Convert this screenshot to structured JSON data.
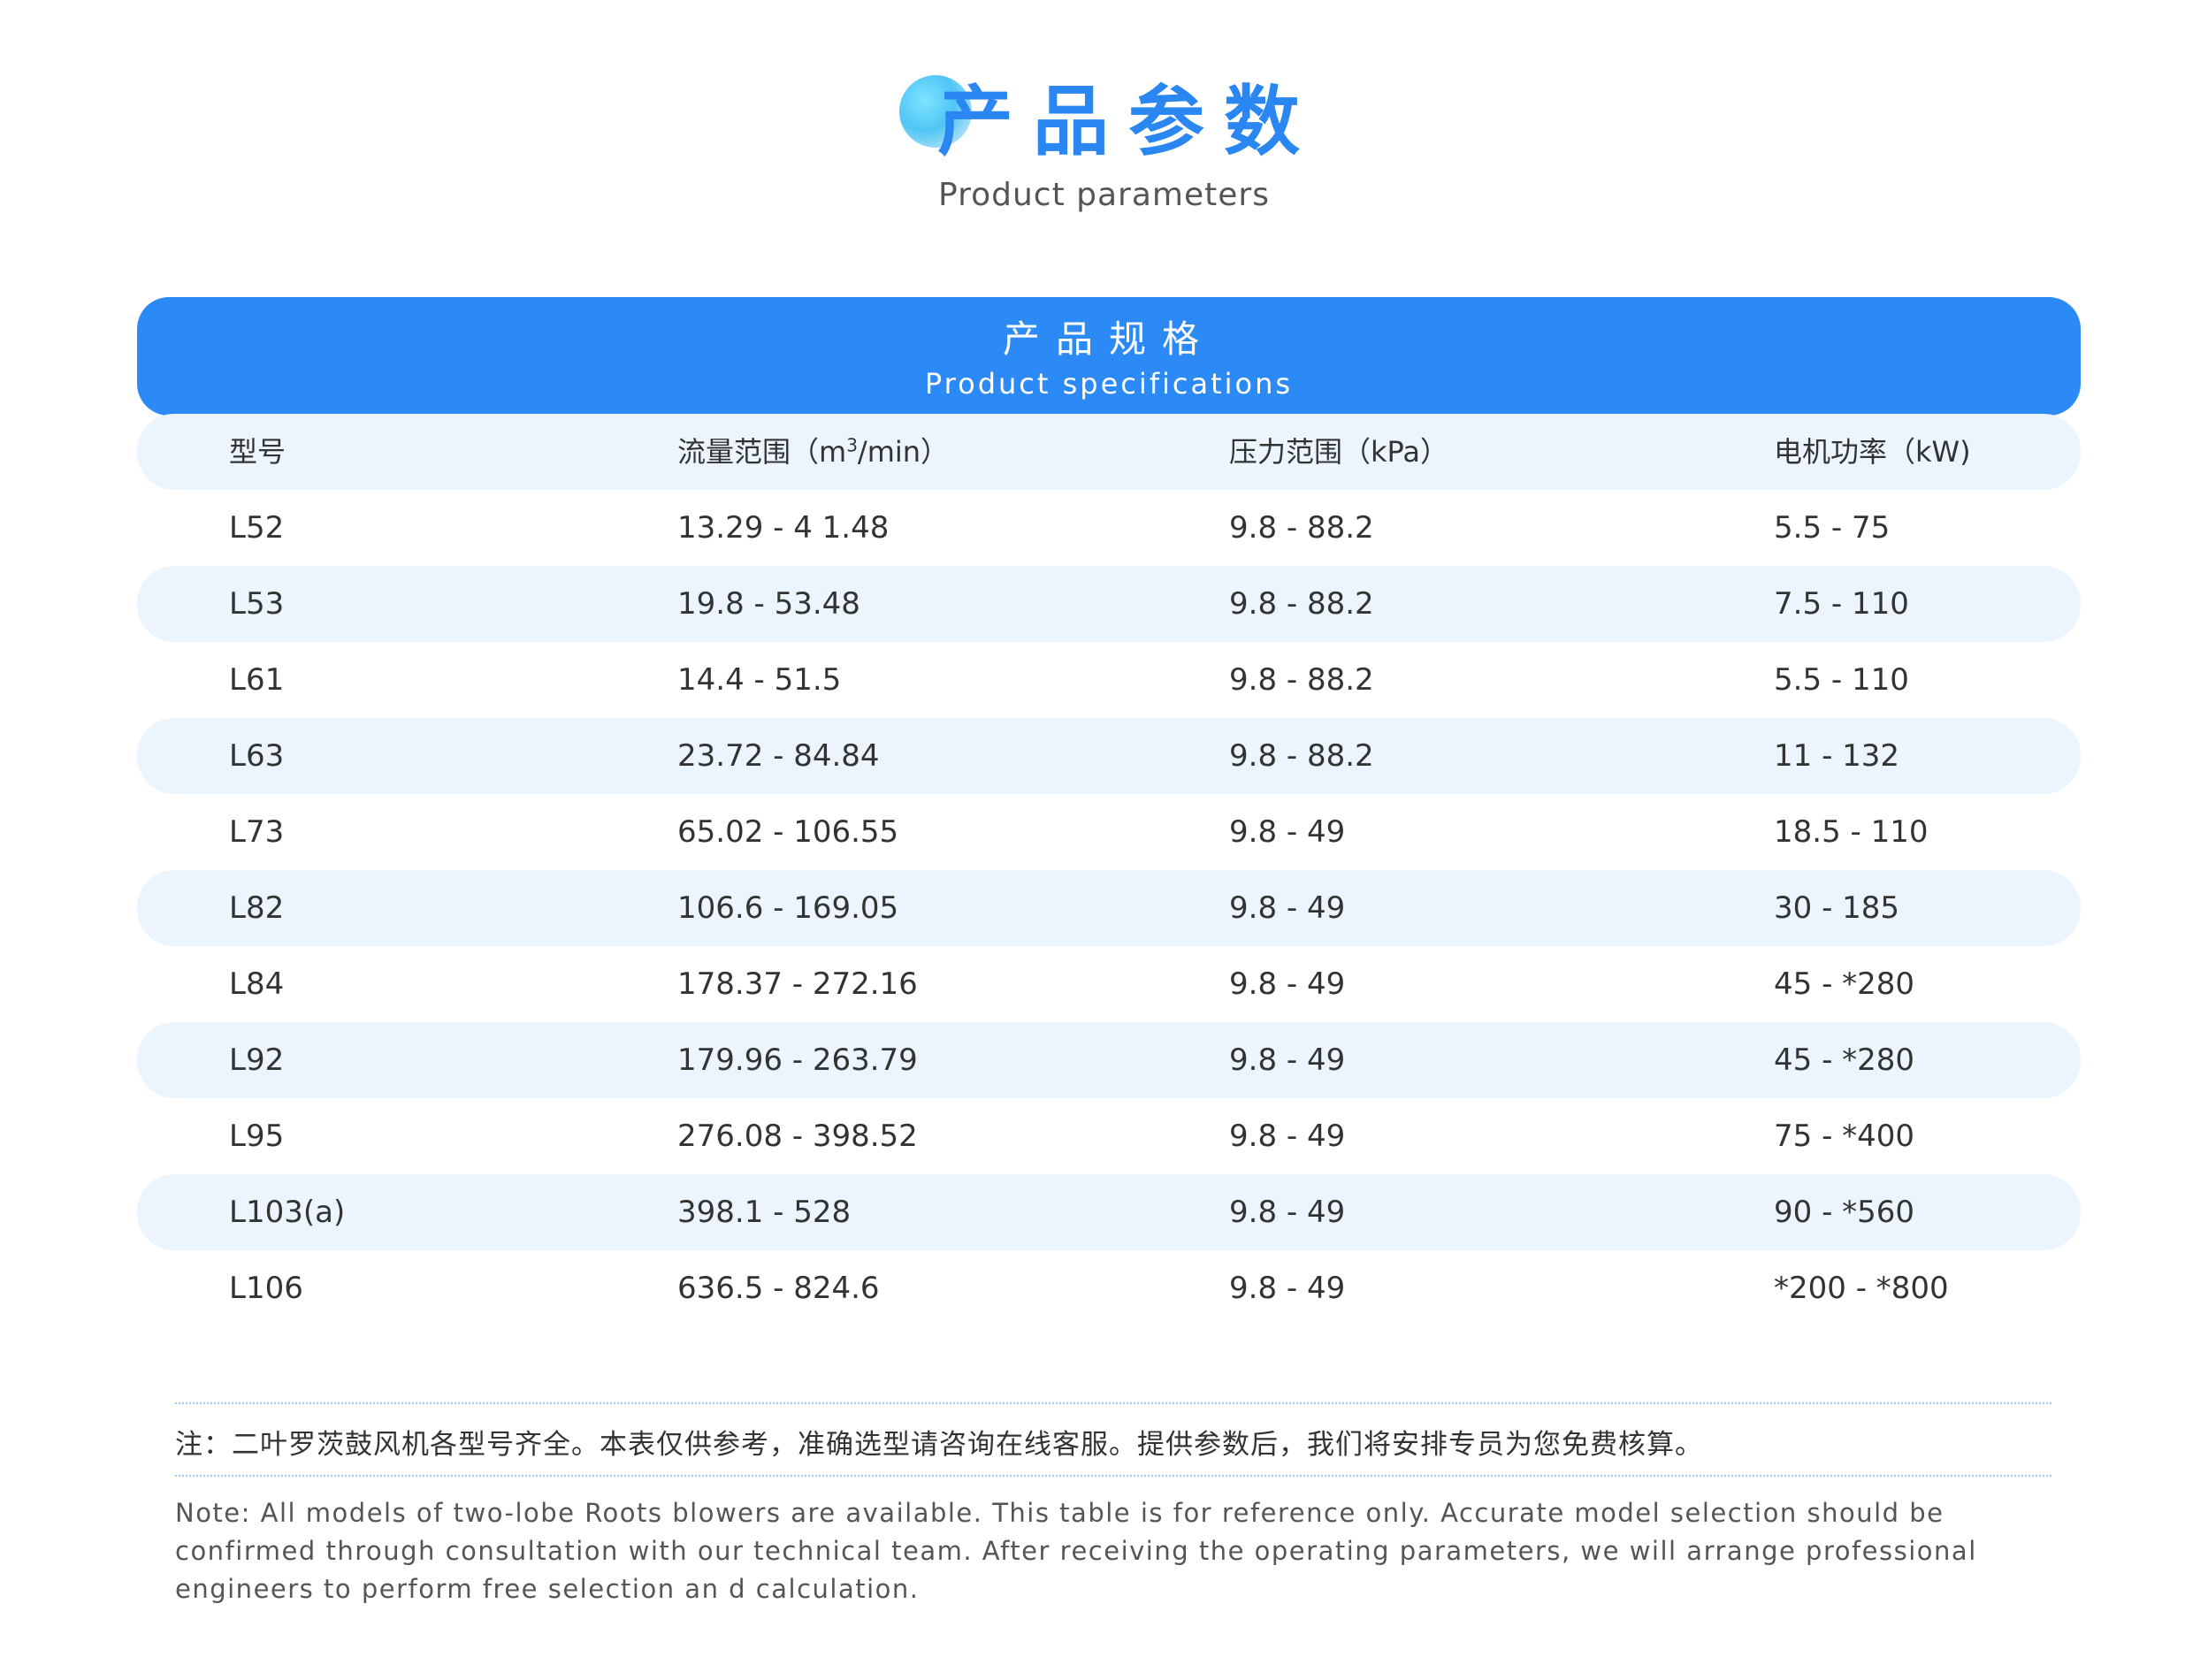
{
  "heading": {
    "title": "产品参数",
    "subtitle": "Product parameters"
  },
  "table": {
    "title": "产品规格",
    "subtitle": "Product specifications",
    "columns": {
      "model": "型号",
      "flow_prefix": "流量范围（m",
      "flow_sup": "3",
      "flow_suffix": "/min）",
      "pressure": "压力范围（kPa）",
      "power": "电机功率（kW)"
    },
    "rows": [
      {
        "model": "L52",
        "flow": "13.29  - 4 1.48",
        "pressure": "9.8 - 88.2",
        "power": "5.5 - 75"
      },
      {
        "model": "L53",
        "flow": "19.8  - 53.48",
        "pressure": "9.8 - 88.2",
        "power": "7.5 - 110"
      },
      {
        "model": "L61",
        "flow": "14.4 - 51.5",
        "pressure": "9.8 - 88.2",
        "power": "5.5 - 110"
      },
      {
        "model": "L63",
        "flow": "23.72 - 84.84",
        "pressure": "9.8 - 88.2",
        "power": "11 - 132"
      },
      {
        "model": "L73",
        "flow": "65.02 - 106.55",
        "pressure": "9.8 - 49",
        "power": "18.5 - 110"
      },
      {
        "model": "L82",
        "flow": "106.6 - 169.05",
        "pressure": "9.8 - 49",
        "power": "30 - 185"
      },
      {
        "model": "L84",
        "flow": "178.37 - 272.16",
        "pressure": "9.8 - 49",
        "power": "45 - *280"
      },
      {
        "model": "L92",
        "flow": "179.96 - 263.79",
        "pressure": "9.8 - 49",
        "power": "45 - *280"
      },
      {
        "model": "L95",
        "flow": "276.08 - 398.52",
        "pressure": "9.8 - 49",
        "power": "75 - *400"
      },
      {
        "model": "L103(a)",
        "flow": "398.1 - 528",
        "pressure": "9.8 - 49",
        "power": "90 - *560"
      },
      {
        "model": "L106",
        "flow": "636.5 - 824.6",
        "pressure": "9.8 - 49",
        "power": "*200 - *800"
      }
    ]
  },
  "notes": {
    "zh": "注：二叶罗茨鼓风机各型号齐全。本表仅供参考，准确选型请咨询在线客服。提供参数后，我们将安排专员为您免费核算。",
    "en": "Note: All models of two-lobe Roots blowers are available. This table is for reference only. Accurate model selection should be confirmed through consultation with our technical team. After receiving the operating parameters, we will arrange professional engineers to perform free selection an d calculation."
  },
  "colors": {
    "accent": "#2b8af5",
    "row_shade": "#ecf5fd",
    "title_blue": "#2a86f0"
  }
}
